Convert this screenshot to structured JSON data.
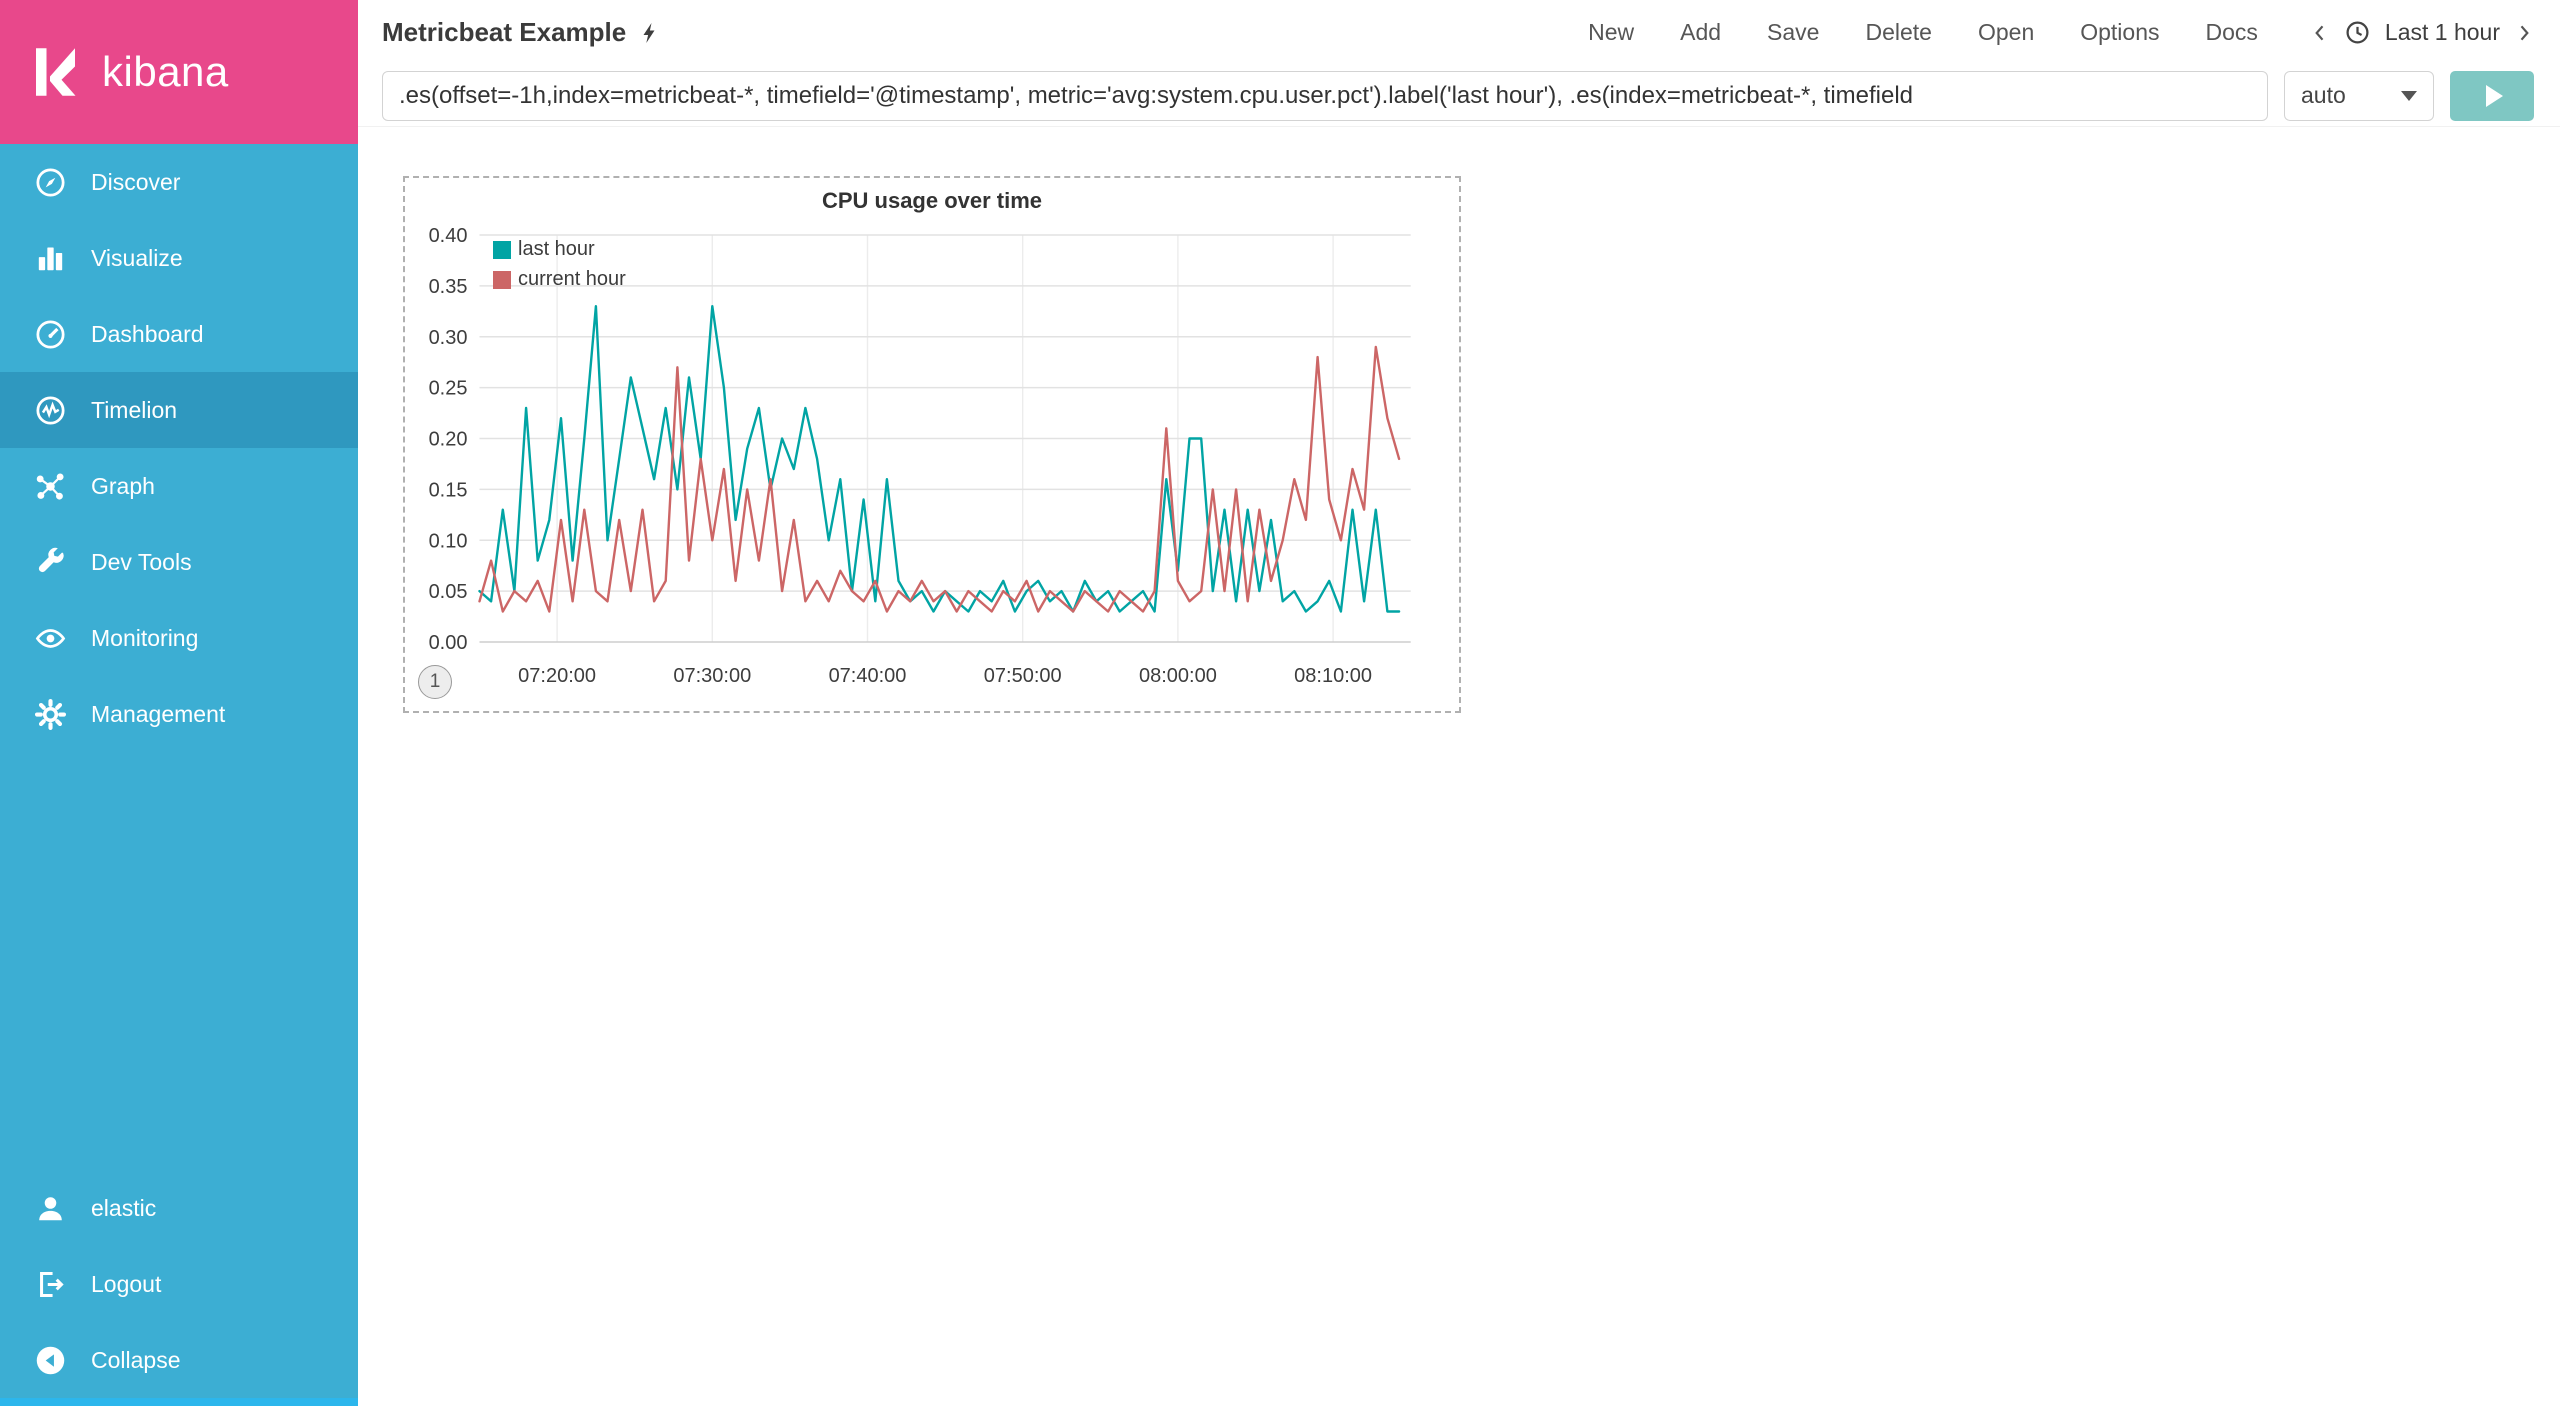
{
  "colors": {
    "brand_pink": "#e8488b",
    "sidebar_blue": "#3caed3",
    "sidebar_active": "#2f98bf",
    "series_teal": "#01a4a4",
    "series_red": "#cc6666",
    "play_button": "#7fc7c3"
  },
  "sidebar": {
    "logo_text": "kibana",
    "items": [
      {
        "label": "Discover",
        "icon": "compass-icon"
      },
      {
        "label": "Visualize",
        "icon": "bar-chart-icon"
      },
      {
        "label": "Dashboard",
        "icon": "gauge-icon"
      },
      {
        "label": "Timelion",
        "icon": "timelion-icon",
        "active": true
      },
      {
        "label": "Graph",
        "icon": "graph-network-icon"
      },
      {
        "label": "Dev Tools",
        "icon": "wrench-icon"
      },
      {
        "label": "Monitoring",
        "icon": "eye-icon"
      },
      {
        "label": "Management",
        "icon": "gear-icon"
      }
    ],
    "footer_items": [
      {
        "label": "elastic",
        "icon": "user-icon"
      },
      {
        "label": "Logout",
        "icon": "logout-icon"
      },
      {
        "label": "Collapse",
        "icon": "collapse-icon"
      }
    ]
  },
  "header": {
    "title": "Metricbeat Example",
    "menu": [
      "New",
      "Add",
      "Save",
      "Delete",
      "Open",
      "Options",
      "Docs"
    ],
    "time_picker": "Last 1 hour"
  },
  "query": {
    "value": ".es(offset=-1h,index=metricbeat-*, timefield='@timestamp', metric='avg:system.cpu.user.pct').label('last hour'), .es(index=metricbeat-*, timefield",
    "interval": "auto"
  },
  "panel": {
    "badge": "1"
  },
  "chart_data": {
    "type": "line",
    "title": "CPU usage over time",
    "xlabel": "",
    "ylabel": "",
    "ylim": [
      0,
      0.4
    ],
    "y_ticks": [
      0.0,
      0.05,
      0.1,
      0.15,
      0.2,
      0.25,
      0.3,
      0.35,
      0.4
    ],
    "x_start": "07:15:00",
    "x_end": "08:15:00",
    "interval_seconds": 45,
    "x_tick_labels": [
      "07:20:00",
      "07:30:00",
      "07:40:00",
      "07:50:00",
      "08:00:00",
      "08:10:00"
    ],
    "grid": true,
    "legend_position": "top-left",
    "series": [
      {
        "name": "last hour",
        "color": "#01a4a4",
        "values": [
          0.05,
          0.04,
          0.13,
          0.05,
          0.23,
          0.08,
          0.12,
          0.22,
          0.08,
          0.2,
          0.33,
          0.1,
          0.18,
          0.26,
          0.21,
          0.16,
          0.23,
          0.15,
          0.26,
          0.18,
          0.33,
          0.25,
          0.12,
          0.19,
          0.23,
          0.15,
          0.2,
          0.17,
          0.23,
          0.18,
          0.1,
          0.16,
          0.05,
          0.14,
          0.04,
          0.16,
          0.06,
          0.04,
          0.05,
          0.03,
          0.05,
          0.04,
          0.03,
          0.05,
          0.04,
          0.06,
          0.03,
          0.05,
          0.06,
          0.04,
          0.05,
          0.03,
          0.06,
          0.04,
          0.05,
          0.03,
          0.04,
          0.05,
          0.03,
          0.16,
          0.07,
          0.2,
          0.2,
          0.05,
          0.13,
          0.04,
          0.13,
          0.05,
          0.12,
          0.04,
          0.05,
          0.03,
          0.04,
          0.06,
          0.03,
          0.13,
          0.04,
          0.13,
          0.03,
          0.03
        ]
      },
      {
        "name": "current hour",
        "color": "#cc6666",
        "values": [
          0.04,
          0.08,
          0.03,
          0.05,
          0.04,
          0.06,
          0.03,
          0.12,
          0.04,
          0.13,
          0.05,
          0.04,
          0.12,
          0.05,
          0.13,
          0.04,
          0.06,
          0.27,
          0.08,
          0.18,
          0.1,
          0.17,
          0.06,
          0.15,
          0.08,
          0.16,
          0.05,
          0.12,
          0.04,
          0.06,
          0.04,
          0.07,
          0.05,
          0.04,
          0.06,
          0.03,
          0.05,
          0.04,
          0.06,
          0.04,
          0.05,
          0.03,
          0.05,
          0.04,
          0.03,
          0.05,
          0.04,
          0.06,
          0.03,
          0.05,
          0.04,
          0.03,
          0.05,
          0.04,
          0.03,
          0.05,
          0.04,
          0.03,
          0.05,
          0.21,
          0.06,
          0.04,
          0.05,
          0.15,
          0.05,
          0.15,
          0.04,
          0.13,
          0.06,
          0.1,
          0.16,
          0.12,
          0.28,
          0.14,
          0.1,
          0.17,
          0.13,
          0.29,
          0.22,
          0.18
        ]
      }
    ]
  }
}
